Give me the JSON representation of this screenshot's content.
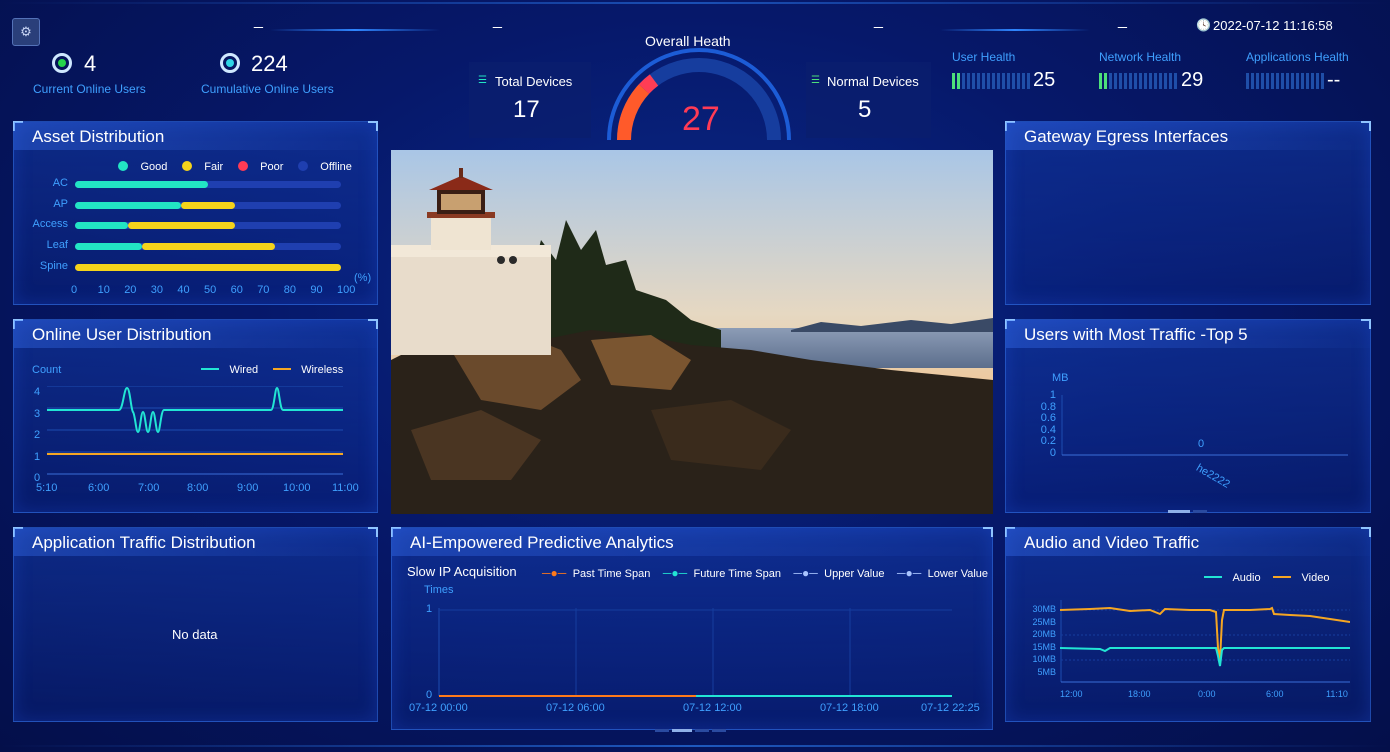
{
  "header": {
    "datetime": "2022-07-12 11:16:58",
    "overall_title": "Overall Heath",
    "overall_value": "27",
    "current_online_users": {
      "value": "4",
      "label": "Current Online Users"
    },
    "cumulative_online_users": {
      "value": "224",
      "label": "Cumulative Online Users"
    },
    "total_devices": {
      "label": "Total Devices",
      "value": "17"
    },
    "normal_devices": {
      "label": "Normal Devices",
      "value": "5"
    },
    "user_health": {
      "label": "User Health",
      "value": "25"
    },
    "network_health": {
      "label": "Network Health",
      "value": "29"
    },
    "applications_health": {
      "label": "Applications Health",
      "value": "--"
    },
    "dashes": [
      "_",
      "_",
      "_",
      "_"
    ]
  },
  "asset_distribution": {
    "title": "Asset Distribution",
    "legend": [
      "Good",
      "Fair",
      "Poor",
      "Offline"
    ],
    "colors": {
      "good": "#22e5c4",
      "fair": "#f5d31b",
      "poor": "#ff3b55",
      "offline": "#1f3fb0"
    },
    "unit": "(%)",
    "ticks": [
      "0",
      "10",
      "20",
      "30",
      "40",
      "50",
      "60",
      "70",
      "80",
      "90",
      "100"
    ],
    "chart_data": {
      "type": "bar",
      "categories": [
        "AC",
        "AP",
        "Access",
        "Leaf",
        "Spine"
      ],
      "series": [
        {
          "name": "Good",
          "values": [
            50,
            40,
            20,
            25,
            0
          ]
        },
        {
          "name": "Fair",
          "values": [
            0,
            20,
            40,
            50,
            100
          ]
        },
        {
          "name": "Poor",
          "values": [
            0,
            0,
            0,
            0,
            0
          ]
        },
        {
          "name": "Offline",
          "values": [
            50,
            40,
            40,
            25,
            0
          ]
        }
      ]
    }
  },
  "online_user_distribution": {
    "title": "Online User Distribution",
    "ylabel": "Count",
    "legend": [
      "Wired",
      "Wireless"
    ],
    "yticks": [
      "4",
      "3",
      "2",
      "1",
      "0"
    ],
    "xticks": [
      "5:10",
      "6:00",
      "7:00",
      "8:00",
      "9:00",
      "10:00",
      "11:00"
    ]
  },
  "application_traffic": {
    "title": "Application Traffic Distribution",
    "empty": "No data"
  },
  "gateway_egress": {
    "title": "Gateway Egress Interfaces"
  },
  "top_users": {
    "title": "Users with Most Traffic -Top 5",
    "ylabel": "MB",
    "yticks": [
      "1",
      "0.8",
      "0.6",
      "0.4",
      "0.2",
      "0"
    ],
    "value_label": "0",
    "category": "he2222"
  },
  "predictive": {
    "title": "AI-Empowered Predictive Analytics",
    "subtitle": "Slow IP Acquisition",
    "legend": [
      "Past Time Span",
      "Future Time Span",
      "Upper Value",
      "Lower Value"
    ],
    "ylabel": "Times",
    "yticks": [
      "1",
      "0"
    ],
    "xticks": [
      "07-12 00:00",
      "07-12 06:00",
      "07-12 12:00",
      "07-12 18:00",
      "07-12 22:25"
    ]
  },
  "audio_video": {
    "title": "Audio and Video Traffic",
    "legend": [
      "Audio",
      "Video"
    ],
    "yticks": [
      "30MB",
      "25MB",
      "20MB",
      "15MB",
      "10MB",
      "5MB"
    ],
    "xticks": [
      "12:00",
      "18:00",
      "0:00",
      "6:00",
      "11:10"
    ]
  }
}
